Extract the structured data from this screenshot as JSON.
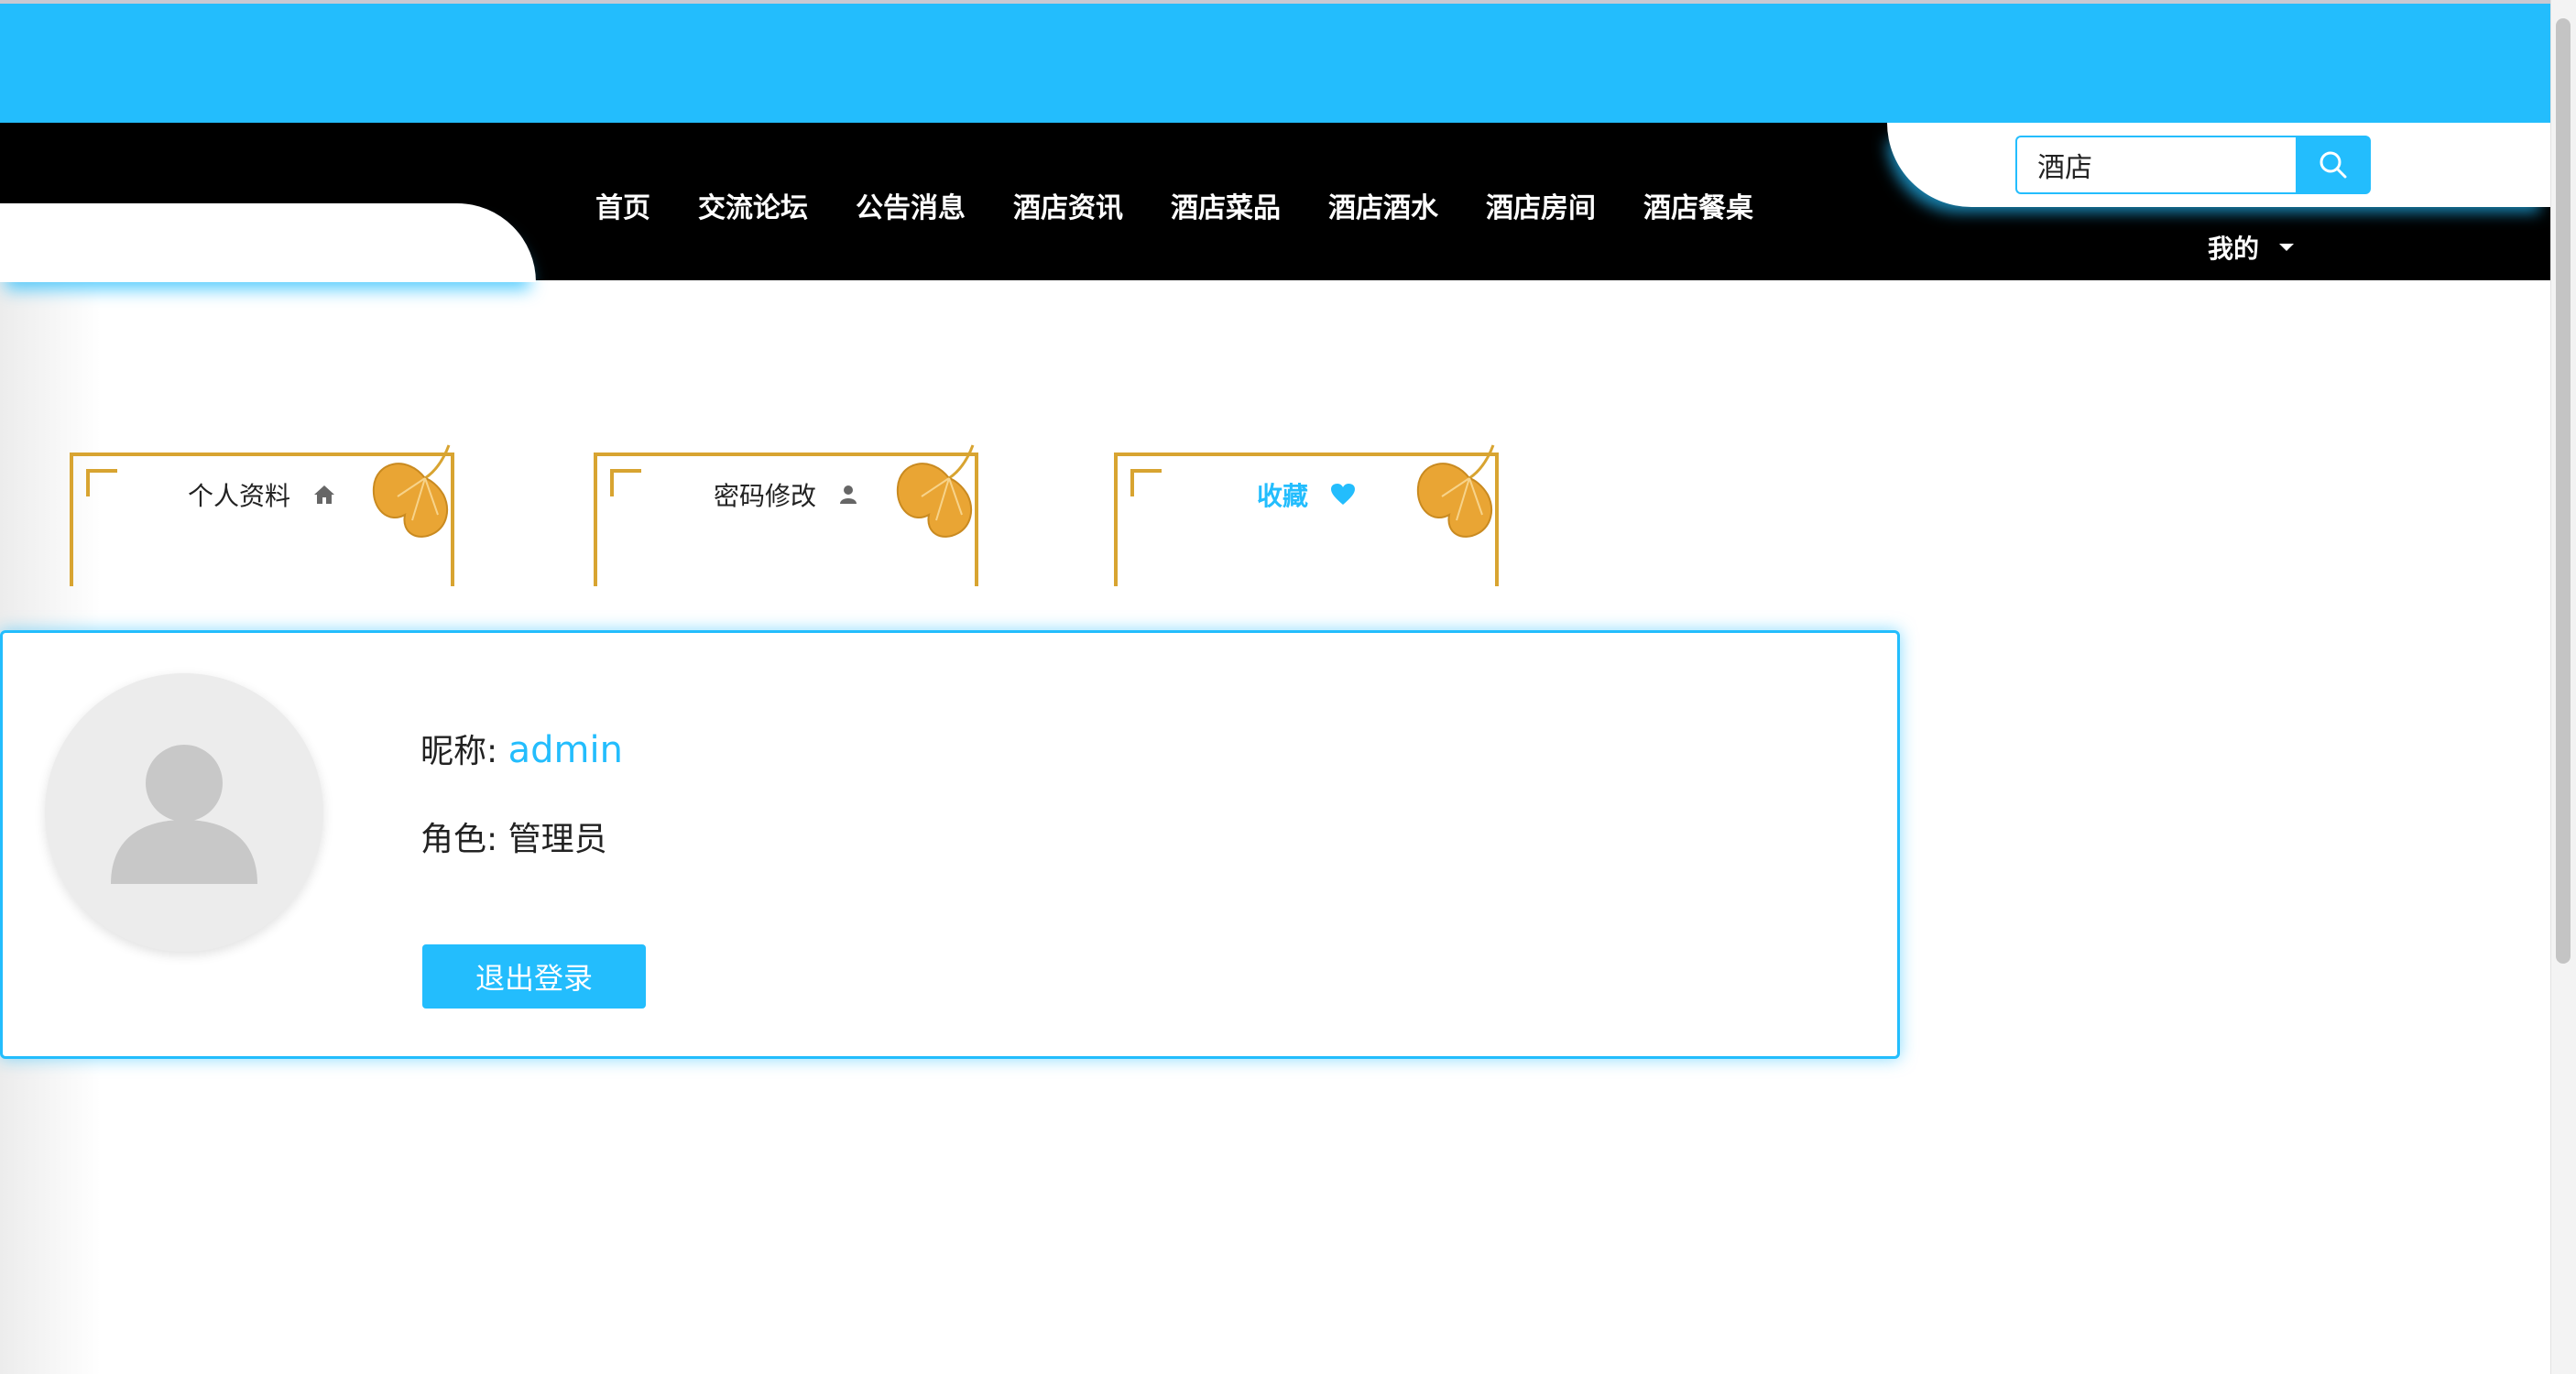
{
  "nav": {
    "items": [
      "首页",
      "交流论坛",
      "公告消息",
      "酒店资讯",
      "酒店菜品",
      "酒店酒水",
      "酒店房间",
      "酒店餐桌"
    ],
    "mine_label": "我的"
  },
  "search": {
    "value": "酒店",
    "icon": "search-icon"
  },
  "tabs": [
    {
      "label": "个人资料",
      "icon": "home-icon",
      "active": false
    },
    {
      "label": "密码修改",
      "icon": "user-icon",
      "active": false
    },
    {
      "label": "收藏",
      "icon": "heart-icon",
      "active": true
    }
  ],
  "profile": {
    "nickname_label": "昵称:",
    "nickname": "admin",
    "role_label": "角色:",
    "role": "管理员",
    "logout_label": "退出登录"
  },
  "colors": {
    "accent": "#23bdfd",
    "nav_bg": "#000000",
    "tab_gold": "#d8a431",
    "leaf": "#e9a534"
  }
}
